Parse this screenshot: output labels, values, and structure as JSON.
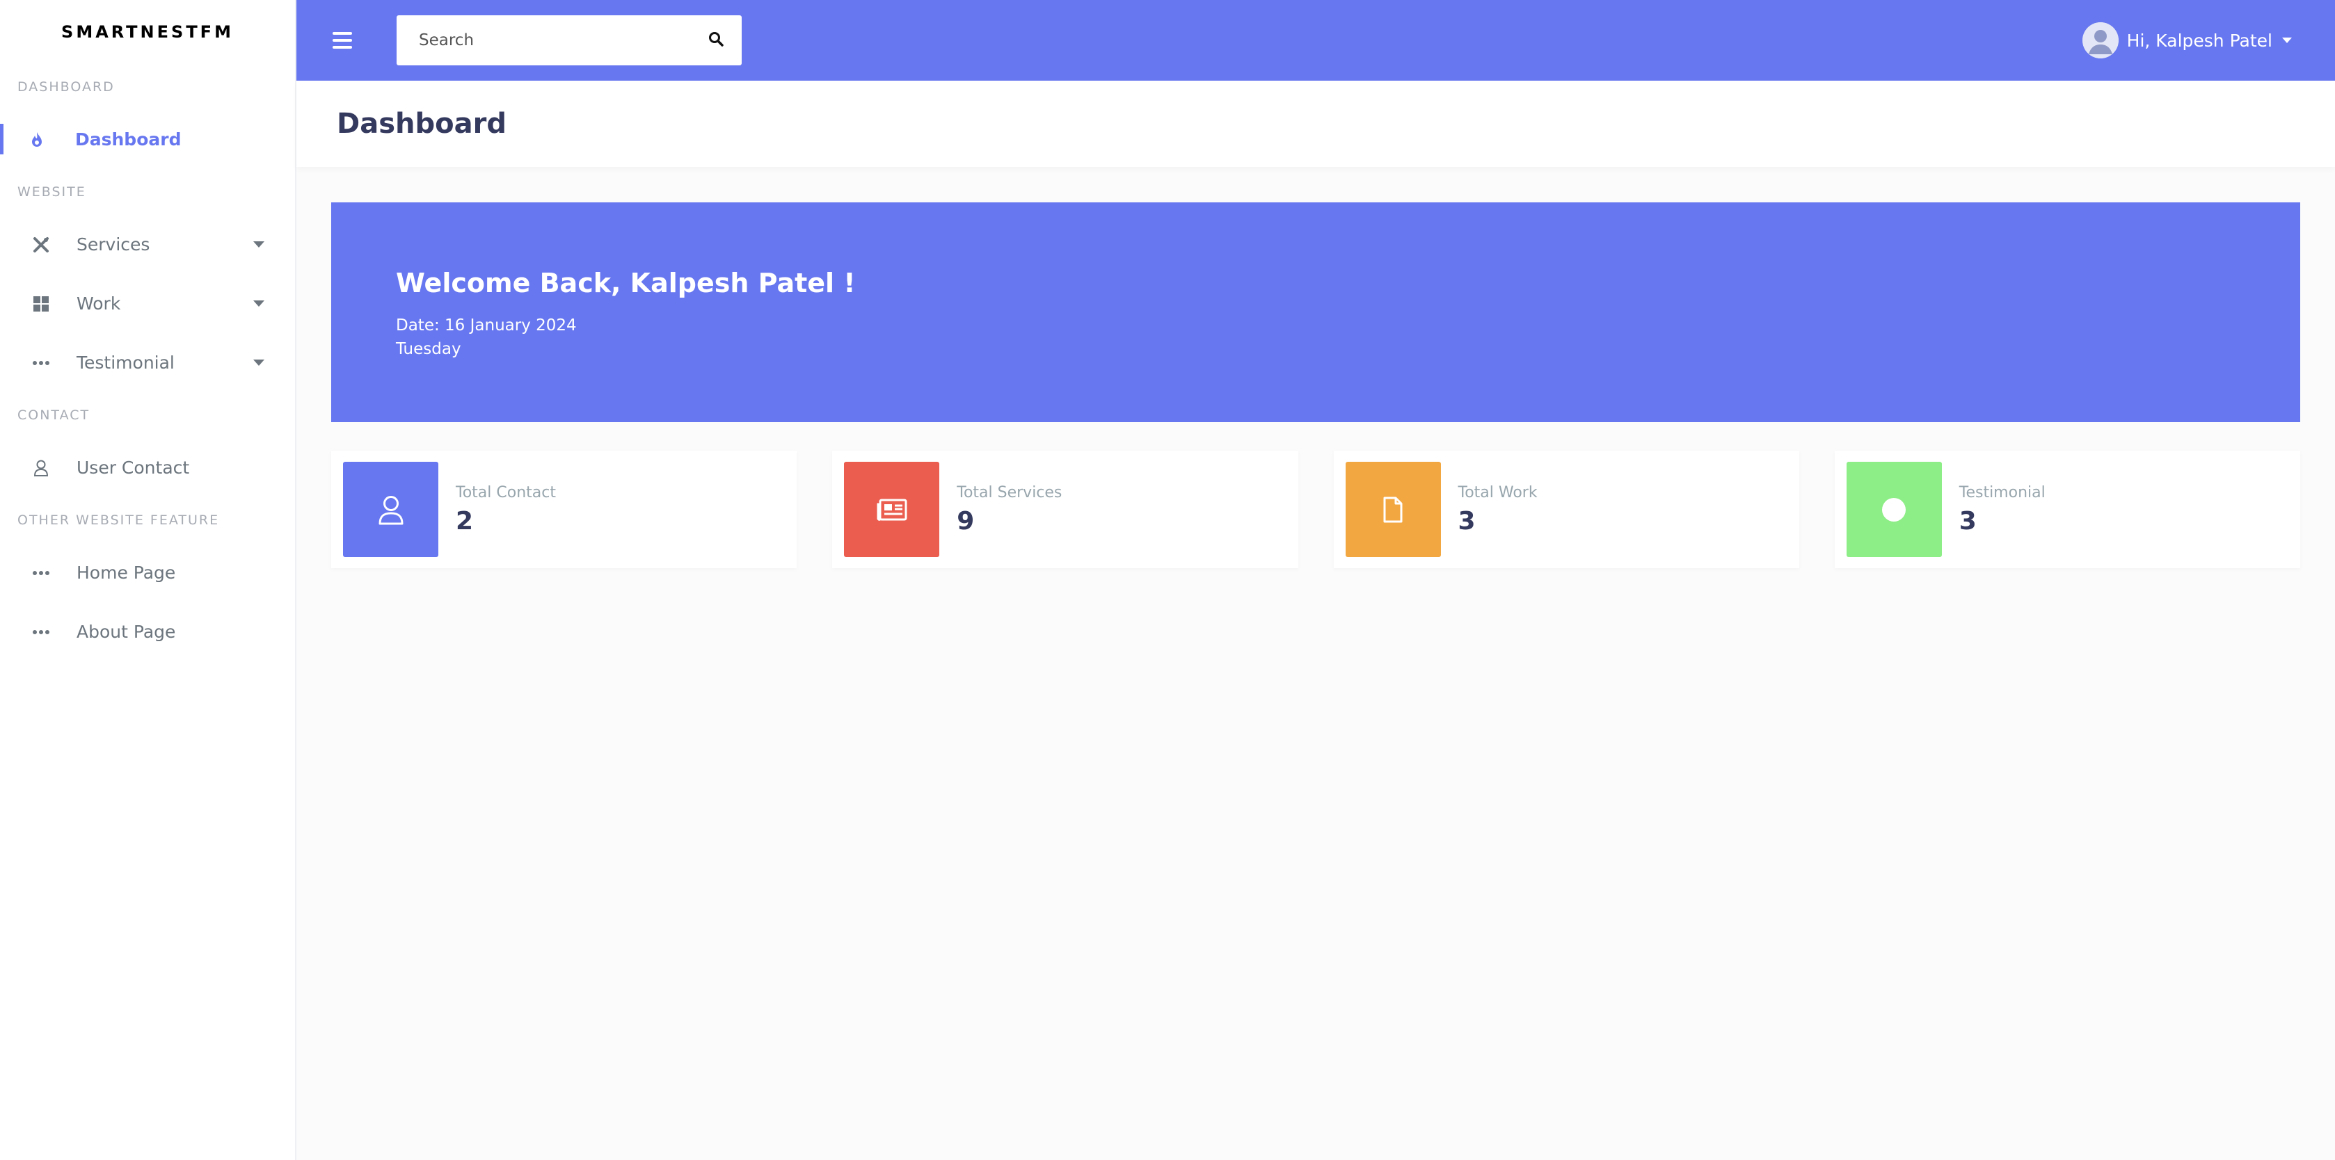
{
  "brand": "SMARTNESTFM",
  "sidebar": {
    "headers": [
      "DASHBOARD",
      "WEBSITE",
      "CONTACT",
      "OTHER WEBSITE FEATURE"
    ],
    "items": [
      {
        "label": "Dashboard",
        "icon": "fire-icon"
      },
      {
        "label": "Services",
        "icon": "tools-icon"
      },
      {
        "label": "Work",
        "icon": "grid-icon"
      },
      {
        "label": "Testimonial",
        "icon": "ellipsis-icon"
      },
      {
        "label": "User Contact",
        "icon": "user-icon"
      },
      {
        "label": "Home Page",
        "icon": "ellipsis-icon"
      },
      {
        "label": "About Page",
        "icon": "ellipsis-icon"
      }
    ]
  },
  "topbar": {
    "search_placeholder": "Search",
    "user_greeting": "Hi, Kalpesh Patel"
  },
  "page_title": "Dashboard",
  "welcome": {
    "heading": "Welcome Back, Kalpesh Patel !",
    "date": "Date: 16 January 2024",
    "day": "Tuesday"
  },
  "stats": [
    {
      "label": "Total Contact",
      "value": "2",
      "color": "#6777ef",
      "icon": "user-icon"
    },
    {
      "label": "Total Services",
      "value": "9",
      "color": "#fc544b",
      "icon": "newspaper-icon"
    },
    {
      "label": "Total Work",
      "value": "3",
      "color": "#ffa426",
      "icon": "file-icon"
    },
    {
      "label": "Testimonial",
      "value": "3",
      "color": "#63ed7a",
      "icon": "circle-icon"
    }
  ],
  "colors": {
    "primary": "#6777ef"
  }
}
